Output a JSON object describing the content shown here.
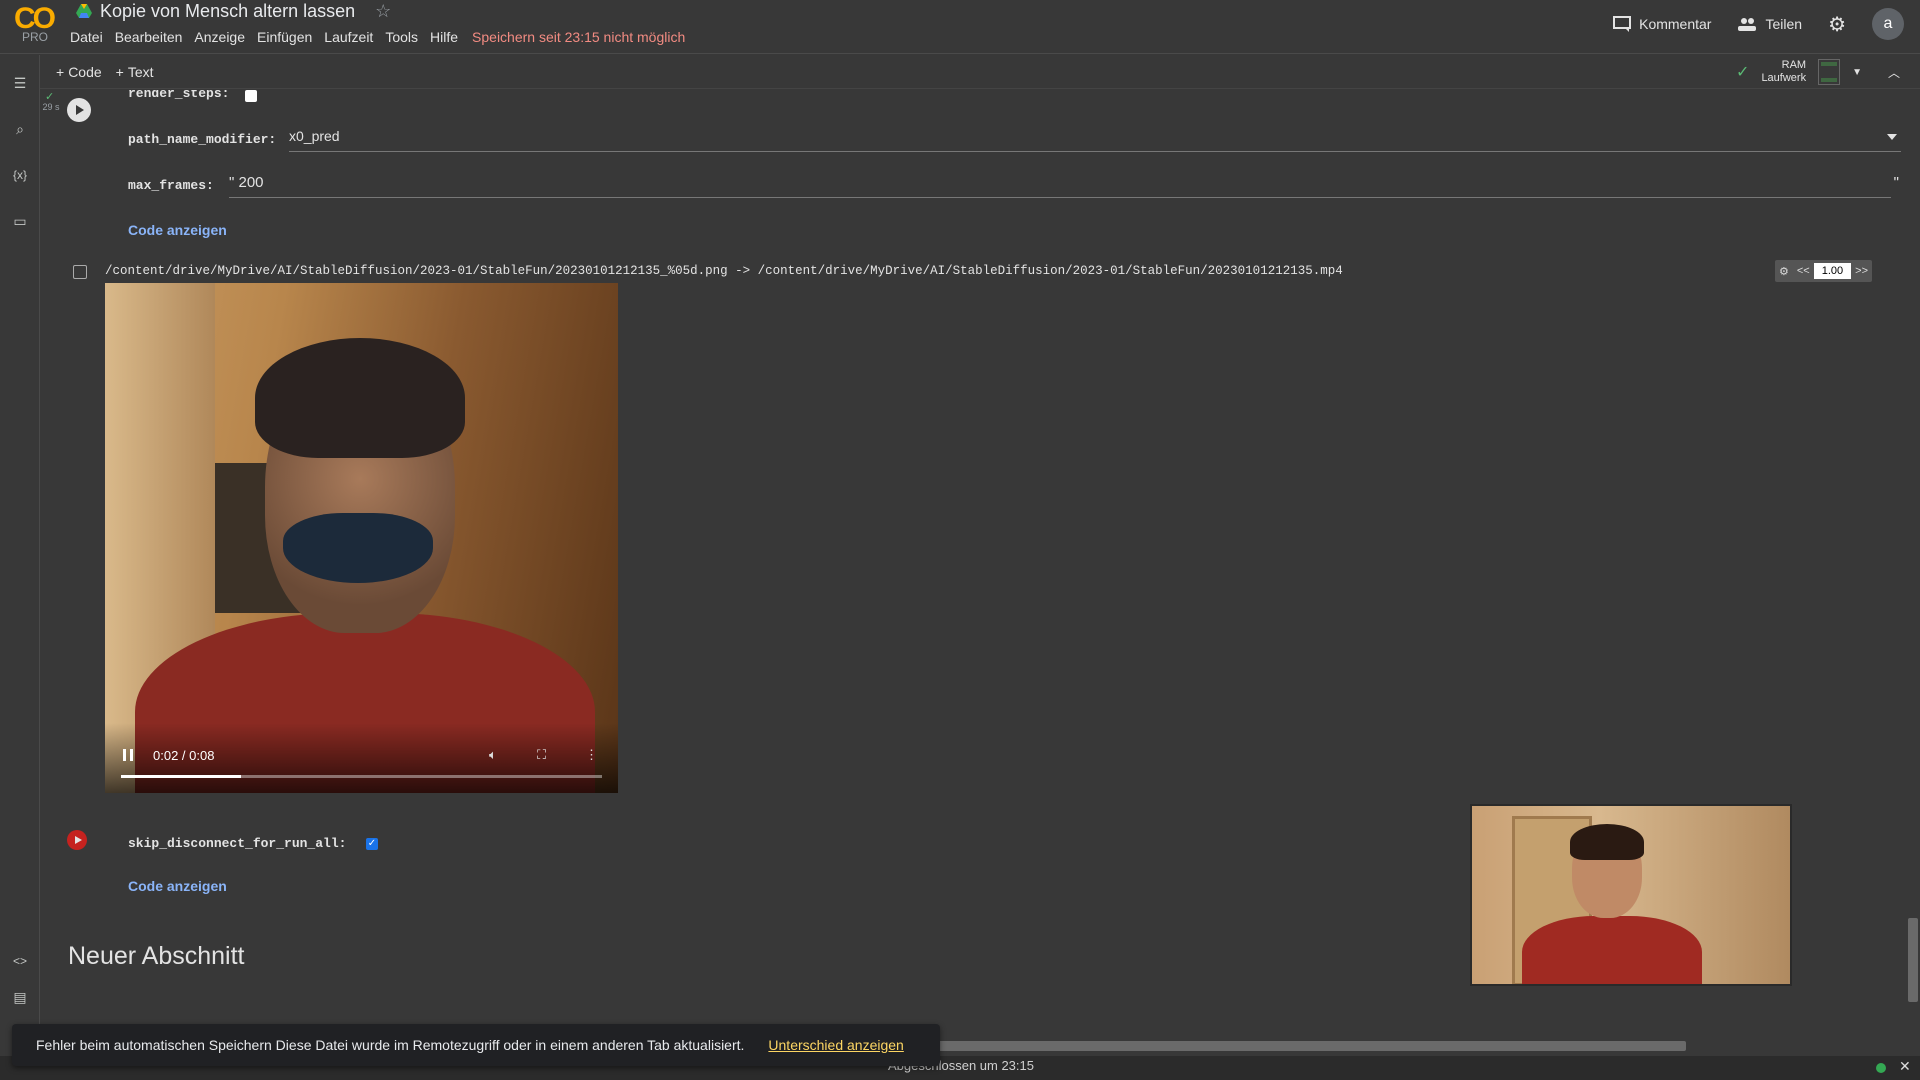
{
  "header": {
    "logo": "CO",
    "logo_sub": "PRO",
    "title": "Kopie von Mensch altern lassen",
    "menu": [
      "Datei",
      "Bearbeiten",
      "Anzeige",
      "Einfügen",
      "Laufzeit",
      "Tools",
      "Hilfe"
    ],
    "save_warning": "Speichern seit 23:15 nicht möglich",
    "comment_label": "Kommentar",
    "share_label": "Teilen",
    "avatar_initial": "a"
  },
  "toolbar": {
    "add_code": "Code",
    "add_text": "Text",
    "ram_label": "RAM",
    "disk_label": "Laufwerk"
  },
  "cell1": {
    "exec_time": "29 s",
    "render_steps_label": "render_steps:",
    "render_steps_checked": false,
    "path_name_modifier_label": "path_name_modifier:",
    "path_name_modifier_value": "x0_pred",
    "max_frames_label": "max_frames:",
    "max_frames_value": "\" 200",
    "max_frames_close_quote": "\"",
    "show_code": "Code anzeigen",
    "output_path": "/content/drive/MyDrive/AI/StableDiffusion/2023-01/StableFun/20230101212135_%05d.png -> /content/drive/MyDrive/AI/StableDiffusion/2023-01/StableFun/20230101212135.mp4",
    "speed_prev": "<<",
    "speed_value": "1.00",
    "speed_next": ">>",
    "video_time": "0:02 / 0:08",
    "video_progress": 0.25
  },
  "cell2": {
    "skip_label": "skip_disconnect_for_run_all:",
    "skip_checked": true,
    "show_code": "Code anzeigen"
  },
  "section": {
    "heading": "Neuer Abschnitt"
  },
  "snackbar": {
    "message": "Fehler beim automatischen Speichern Diese Datei wurde im Remotezugriff oder in einem anderen Tab aktualisiert.",
    "action": "Unterschied anzeigen"
  },
  "status": {
    "text": "Abgeschlossen um 23:15",
    "close": "✕"
  },
  "colors": {
    "background": "#383838",
    "accent_link": "#8ab4f8",
    "warning": "#f28b82",
    "snackbar_action": "#fdd663"
  }
}
